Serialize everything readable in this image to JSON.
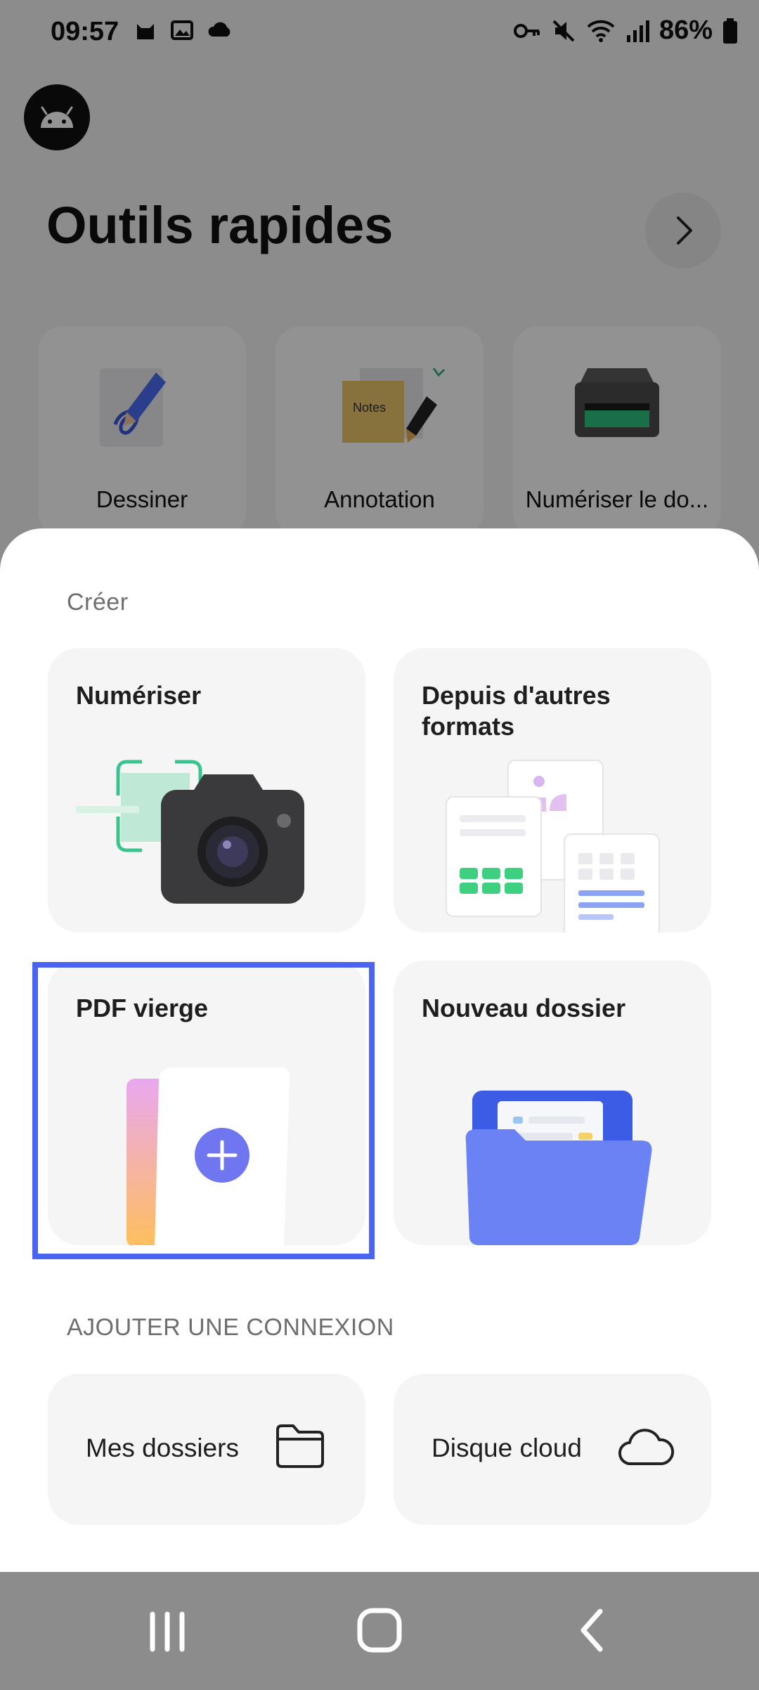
{
  "status_bar": {
    "time": "09:57",
    "battery": "86%",
    "left_icons": [
      "cat-icon",
      "gallery-icon",
      "cloud-icon"
    ],
    "right_icons": [
      "key-icon",
      "mute-icon",
      "wifi-icon",
      "signal-icon",
      "battery-icon"
    ]
  },
  "background": {
    "quick_tools_title": "Outils rapides",
    "tools": [
      {
        "label": "Dessiner",
        "icon": "drawing-icon"
      },
      {
        "label": "Annotation",
        "icon": "notes-icon"
      },
      {
        "label": "Numériser le do...",
        "icon": "scanner-icon"
      }
    ]
  },
  "sheet": {
    "create_label": "Créer",
    "cards": [
      {
        "title": "Numériser",
        "icon": "camera-icon"
      },
      {
        "title": "Depuis d'autres formats",
        "icon": "documents-icon"
      },
      {
        "title": "PDF vierge",
        "icon": "blank-pdf-icon"
      },
      {
        "title": "Nouveau dossier",
        "icon": "folder-icon"
      }
    ],
    "connection_label": "AJOUTER UNE CONNEXION",
    "connections": [
      {
        "label": "Mes dossiers",
        "icon": "folder-outline-icon"
      },
      {
        "label": "Disque cloud",
        "icon": "cloud-outline-icon"
      }
    ]
  },
  "nav_bar": {
    "buttons": [
      "recents-icon",
      "home-icon",
      "back-icon"
    ]
  },
  "colors": {
    "accent": "#4b64f0",
    "card_bg": "#f5f5f5",
    "sheet_bg": "#ffffff"
  }
}
